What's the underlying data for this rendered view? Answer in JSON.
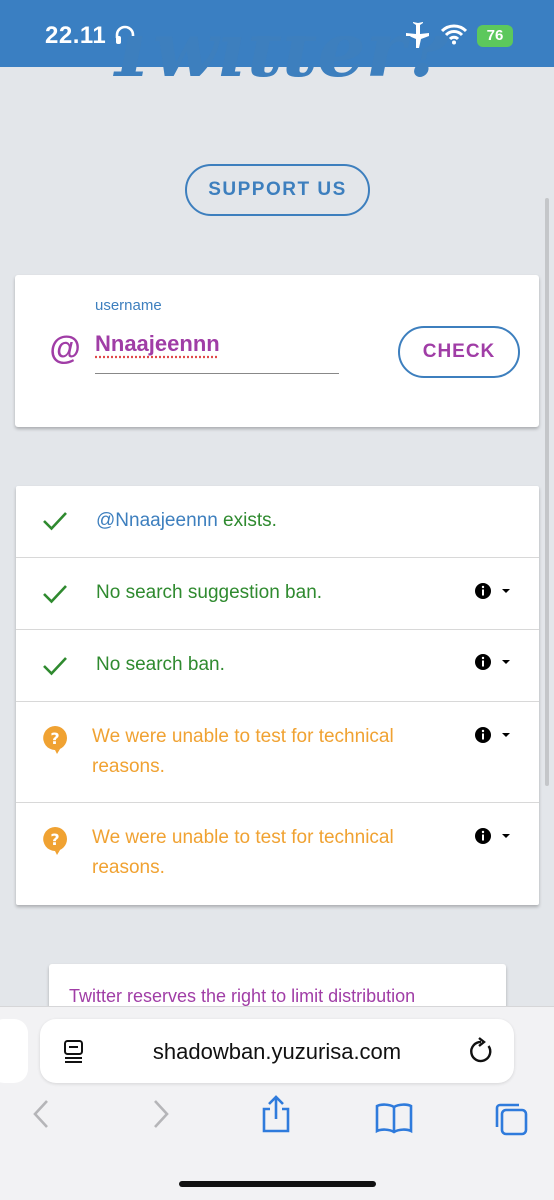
{
  "status_bar": {
    "time": "22.11",
    "battery": "76"
  },
  "hero": {
    "title": "Twitter?",
    "support_label": "SUPPORT US"
  },
  "username_form": {
    "at_symbol": "@",
    "label": "username",
    "value": "Nnaajeennn",
    "check_label": "CHECK"
  },
  "results": [
    {
      "status": "ok",
      "handle": "@Nnaajeennn",
      "text": " exists.",
      "has_info": false
    },
    {
      "status": "ok",
      "text": "No search suggestion ban.",
      "has_info": true
    },
    {
      "status": "ok",
      "text": "No search ban.",
      "has_info": true
    },
    {
      "status": "unknown",
      "text_line1": "We were unable to test for technical",
      "text_line2": "reasons.",
      "has_info": true
    },
    {
      "status": "unknown",
      "text_line1": "We were unable to test for technical",
      "text_line2": "reasons.",
      "has_info": true
    }
  ],
  "teaser": {
    "text": "Twitter reserves the right to limit distribution"
  },
  "browser": {
    "url": "shadowban.yuzurisa.com",
    "icons": [
      "page-format-icon",
      "reload-icon",
      "back-icon",
      "forward-icon",
      "share-icon",
      "bookmarks-icon",
      "tabs-icon"
    ]
  },
  "colors": {
    "brand_blue": "#3d7fbe",
    "purple": "#a03da6",
    "success_green": "#2f8a2f",
    "warning_orange": "#f0a232",
    "ios_blue": "#2f7bdc"
  }
}
